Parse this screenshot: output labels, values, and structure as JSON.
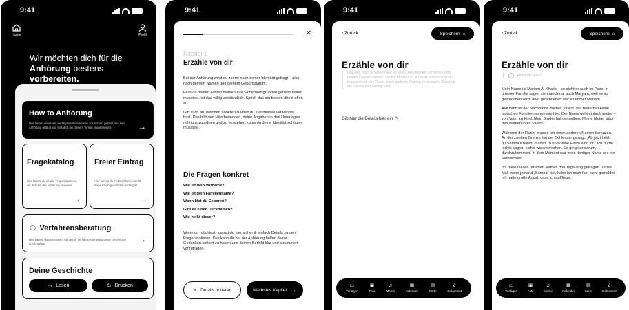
{
  "status": {
    "time": "9:41"
  },
  "screen1": {
    "home_label": "Home",
    "profil_label": "Profil",
    "headline_line1": "Wir möchten dich für die",
    "headline_bold1": "Anhörung",
    "headline_mid": " bestens ",
    "headline_bold2": "vorbereiten.",
    "cards": {
      "how_to": {
        "title": "How to Anhörung",
        "desc": "Hier haben wir dir alle wichtigen Informationen zusammen gestellt, wie eine Anhörung abläuft und was dich bei diesem Termin erwarten wird."
      },
      "fragekatalog": {
        "title": "Fragekatalog",
        "desc": "Hier kannst du dir alle Fragen ansehen, die dich bei der Anhörung erwarten."
      },
      "freier": {
        "title": "Freier Eintrag",
        "desc": "Hier kannst du frei Berichten, was für deine Fluchtgeschichte wichtig ist."
      },
      "verfahren": {
        "title": "Verfahrensberatung",
        "desc": "Hier kannst du gemeinsam mit deiner Verfahrensberatung deine Geschichte durch gehen."
      },
      "geschichte": {
        "title": "Deine Geschichte",
        "lesen": "Lesen",
        "drucken": "Drucken"
      }
    }
  },
  "screen2": {
    "progress": 0.18,
    "kapitel": "Kaptiel 1",
    "title": "Erzähle von dir",
    "paragraphs": [
      "Bei der Anhörung wirst du zuerst nach deiner Identität gefragt – also nach deinem Namen und deinem Geburtsdatum.",
      "Falls du deinen echten Namen aus Sicherheitsgründen geheim halten musstest, ist das völlig verständlich. Sprich das am besten direkt offen an.",
      "Gib auch an, welchen anderen Namen du stattdessen verwendet hast. Das hilft den Mitarbeitenden, deine Angaben in den Unterlagen richtig zuzuordnen und zu verstehen, dass du deine Identität schützen musstest."
    ],
    "questions_title": "Die Fragen konkret",
    "questions": [
      "Wie ist dein Vorname?",
      "Wie ist dein Familienname?",
      "Wann bist du Geboren?",
      "Gibt es einen Decknamen?",
      "Wie heißt dieser?"
    ],
    "footer": "Wenn du möchtest, kannst du hier sicher & einfach Details zu den Fragen notieren. Das kann dir bei der Anhörung helfen deine Gedanken sortiert zu haben und deinen Bericht klar und strukturiert vorzutragen.",
    "btn_notes": "Details notieren",
    "btn_next": "Nächstes Kapitel"
  },
  "screen3": {
    "back": "Zurück",
    "save": "Speichern",
    "title": "Erzähle von dir",
    "hint": "Das Amt möchte wissen wie du heißt. Also deinen Vornamen und deinen Familiennamen. Vielleicht heißt du ja früher anders oder du musstest auf der Flucht einen anderen Namen verwenden. Das sind die Details hier wichtig sind.",
    "input_placeholder": "Gib hier die Details hier ein"
  },
  "screen4": {
    "back": "Zurück",
    "save": "Speichern",
    "title": "Erzähle von dir",
    "help": "Willst du Hilfe?",
    "paragraphs": [
      "Mein Name ist Mariam Al-Khatib – so steht er auch im Pass. In unserer Familie sagen sie manchmal auch Maryam, weil es so gesprochen wird, aber geschrieben war es immer Mariam.",
      "Al-Khatib ist der Nachname meines Vaters. Wir benutzen keine typischen Familiennamen wie hier. Der Name geht einfach weiter – von Vater zu Kind. Mein Bruder hat denselben. Meine Mutter trägt den Namen ihres Vaters.",
      "Während der Flucht musste ich einen anderen Namen benutzen. An der zweiten Grenze hat der Schleuser gesagt: „Ab jetzt heißt du Samira Khaled, du bist 18 und deine Eltern sind tot.\" Ich durfte nichts sagen, nichts widersprechen. Es ging nur darum, durchzukommen. In dem Moment war mein richtiger Name wie ein Verbrechen.",
      "Ich habe diesen falschen Namen drei Tage lang getragen. Jedes Mal, wenn jemand „Samira\" rief, habe ich mich fast nicht gemeldet. Ich hatte große Angst, dass ich auffliege."
    ]
  },
  "toolbar": {
    "items": [
      {
        "label": "Vorlagen",
        "icon": "templates-icon"
      },
      {
        "label": "Foto",
        "icon": "photo-icon"
      },
      {
        "label": "Memo",
        "icon": "microphone-icon"
      },
      {
        "label": "Kalender",
        "icon": "calendar-icon"
      },
      {
        "label": "Karte",
        "icon": "map-icon"
      },
      {
        "label": "Dokument",
        "icon": "paperclip-icon"
      }
    ]
  }
}
